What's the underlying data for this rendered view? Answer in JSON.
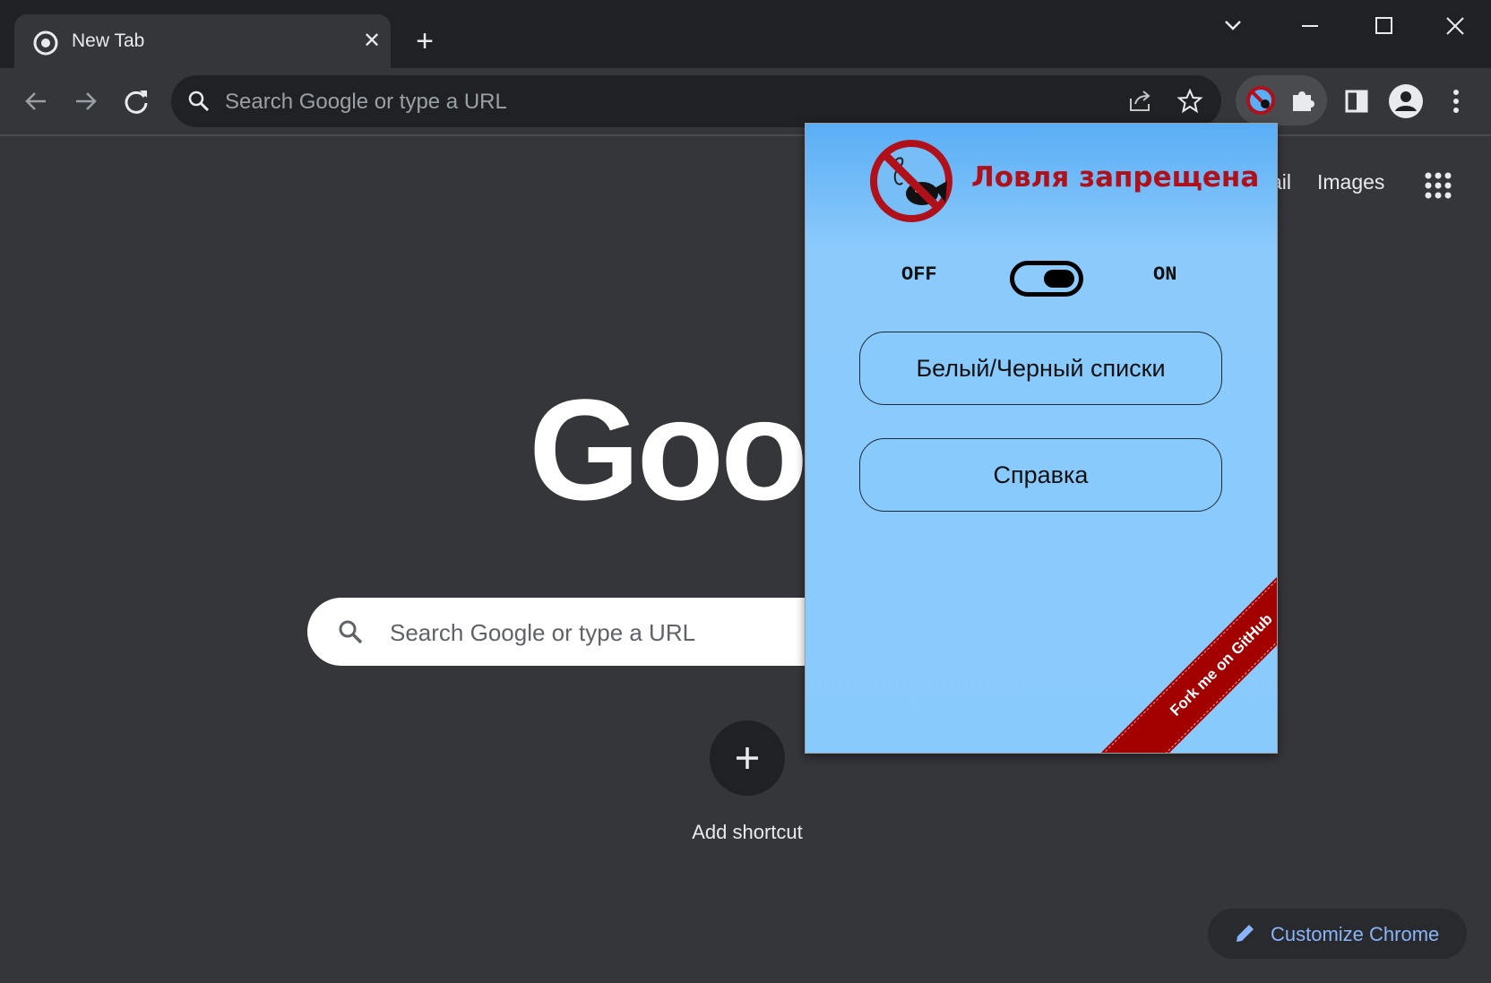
{
  "browser": {
    "tab_title": "New Tab",
    "omnibox_placeholder": "Search Google or type a URL"
  },
  "ntp": {
    "links": [
      "ail",
      "Images"
    ],
    "logo_text": "Goo",
    "search_placeholder": "Search Google or type a URL",
    "add_shortcut_label": "Add shortcut",
    "customize_label": "Customize Chrome"
  },
  "popup": {
    "title": "Ловля запрещена",
    "toggle_off_label": "OFF",
    "toggle_on_label": "ON",
    "toggle_state": "on",
    "lists_button": "Белый/Черный списки",
    "help_button": "Справка",
    "ribbon": "Fork me on GitHub"
  },
  "colors": {
    "popup_title": "#b0101a",
    "ribbon": "#a30000",
    "popup_bg": "#89cafc",
    "customize_text": "#8ab4f8"
  }
}
